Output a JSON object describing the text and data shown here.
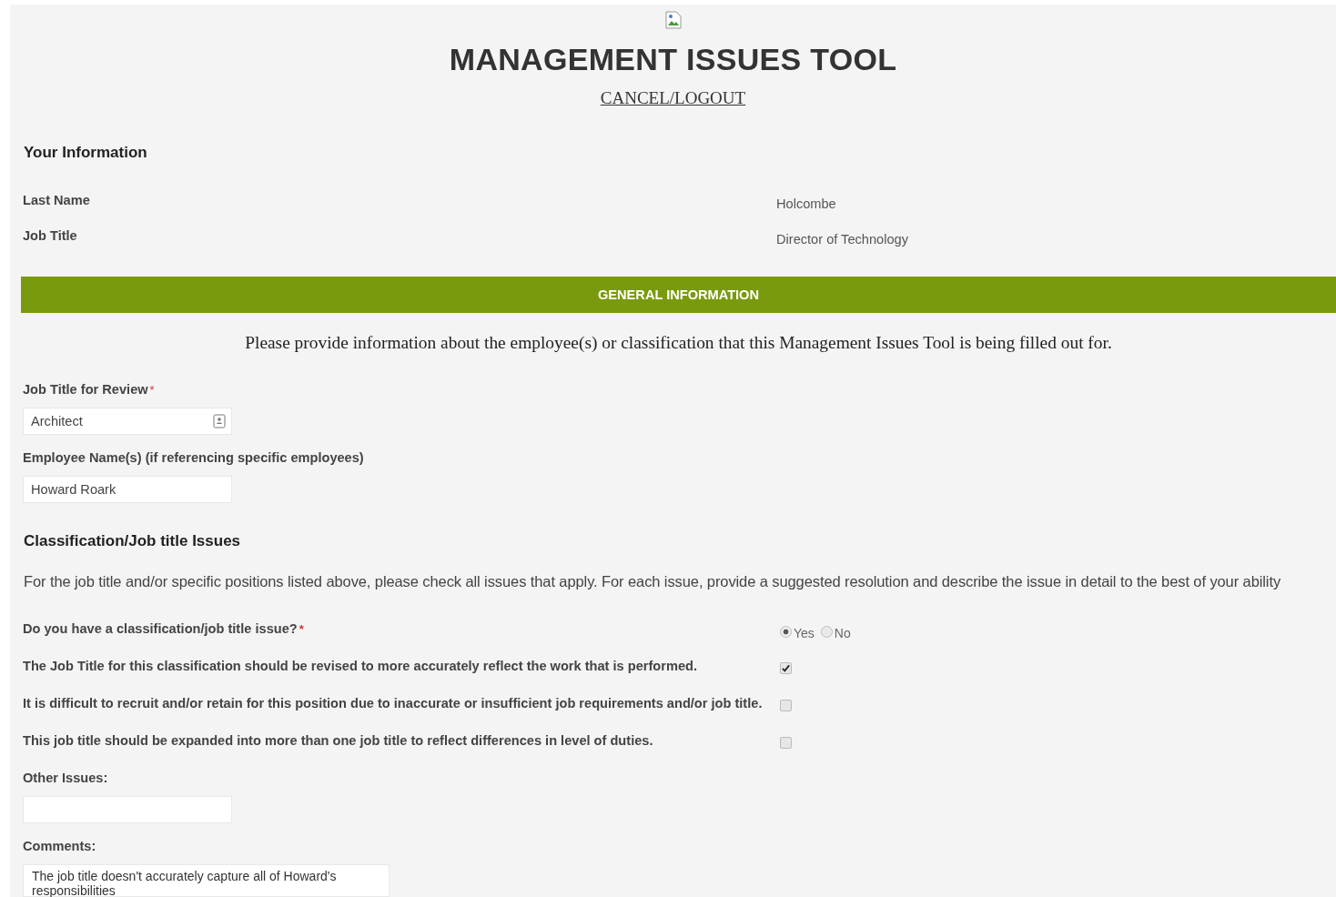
{
  "header": {
    "title": "MANAGEMENT ISSUES TOOL",
    "logout_link": "CANCEL/LOGOUT"
  },
  "your_information": {
    "heading": "Your Information",
    "fields": [
      {
        "label": "Last Name",
        "value": "Holcombe"
      },
      {
        "label": "Job Title",
        "value": "Director of Technology"
      }
    ]
  },
  "general_information": {
    "banner": "GENERAL INFORMATION",
    "intro": "Please provide information about the employee(s) or classification that this Management Issues Tool is being filled out for.",
    "fields": [
      {
        "label": "Job Title for Review",
        "required_mark": "*",
        "value": "Architect",
        "kind": "lookup"
      },
      {
        "label": "Employee Name(s) (if referencing specific employees)",
        "value": "Howard Roark",
        "kind": "text"
      }
    ]
  },
  "classification_issues": {
    "heading": "Classification/Job title Issues",
    "intro": "For the job title and/or specific positions listed above, please check all issues that apply. For each issue, provide a suggested resolution and describe the issue in detail to the best of your ability",
    "rows": [
      {
        "kind": "radio",
        "label": "Do you have a classification/job title issue?",
        "required_mark": "*",
        "options": [
          {
            "label": "Yes",
            "selected": true
          },
          {
            "label": "No",
            "selected": false
          }
        ]
      },
      {
        "kind": "checkbox",
        "label": "The Job Title for this classification should be revised to more accurately reflect the work that is performed.",
        "checked": true
      },
      {
        "kind": "checkbox",
        "label": "It is difficult to recruit and/or retain for this position due to inaccurate or insufficient job requirements and/or job title.",
        "checked": false
      },
      {
        "kind": "checkbox",
        "label": "This job title should be expanded into more than one job title to reflect differences in level of duties.",
        "checked": false
      }
    ],
    "other_issues": {
      "label": "Other Issues:"
    },
    "comments": {
      "label": "Comments:",
      "value": "The job title doesn't accurately capture all of Howard's responsibilities"
    }
  }
}
